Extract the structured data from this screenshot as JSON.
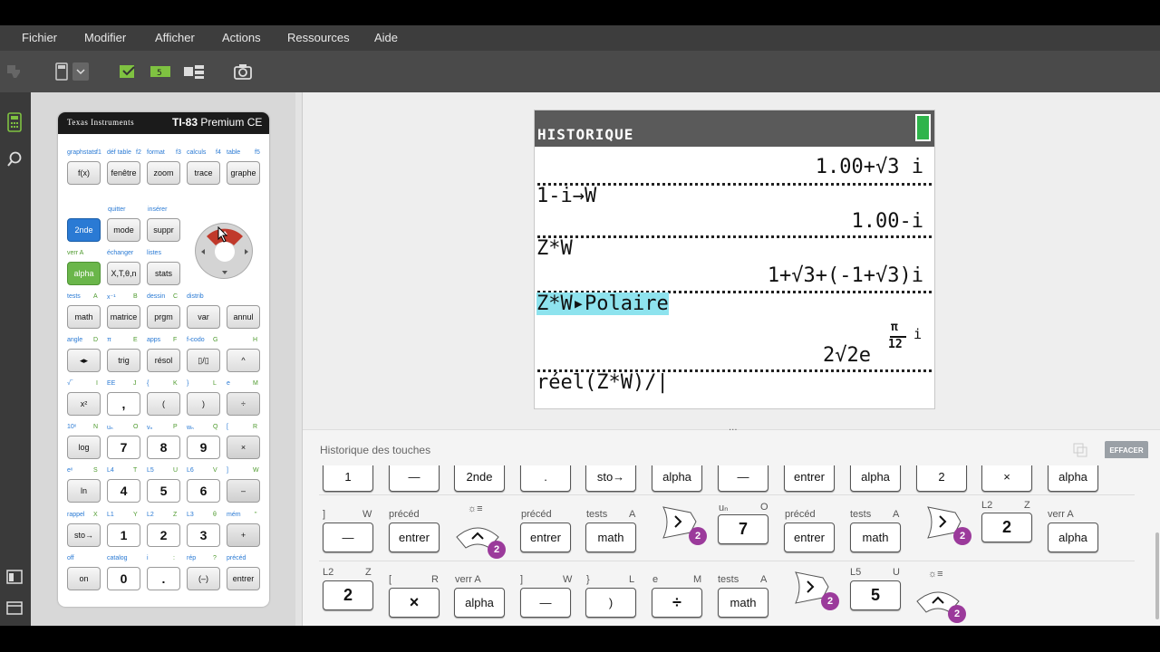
{
  "menu": [
    "Fichier",
    "Modifier",
    "Afficher",
    "Actions",
    "Ressources",
    "Aide"
  ],
  "calc": {
    "brand": "Texas Instruments",
    "model_bold": "TI-83",
    "model_rest": " Premium CE",
    "keys": {
      "fx": "f(x)",
      "fenetre": "fenêtre",
      "zoom": "zoom",
      "trace": "trace",
      "graphe": "graphe",
      "2nde": "2nde",
      "mode": "mode",
      "suppr": "suppr",
      "alpha": "alpha",
      "xtn": "X,T,θ,n",
      "stats": "stats",
      "math": "math",
      "matrice": "matrice",
      "prgm": "prgm",
      "var": "var",
      "annul": "annul",
      "frac": "◂▸",
      "trig": "trig",
      "resol": "résol",
      "frac2": "▯/▯",
      "pow": "^",
      "sq": "x²",
      "comma": ",",
      "lp": "(",
      "rp": ")",
      "div": "÷",
      "log": "log",
      "n7": "7",
      "n8": "8",
      "n9": "9",
      "mul": "×",
      "ln": "ln",
      "n4": "4",
      "n5": "5",
      "n6": "6",
      "minus": "–",
      "sto": "sto→",
      "n1": "1",
      "n2": "2",
      "n3": "3",
      "plus": "+",
      "on": "on",
      "n0": "0",
      "dot": ".",
      "neg": "(–)",
      "entrer": "entrer"
    },
    "labels": {
      "r1": [
        "graphstats",
        "f1",
        "déf table",
        "f2",
        "format",
        "f3",
        "calculs",
        "f4",
        "table",
        "f5"
      ],
      "quitter": "quitter",
      "inserer": "insérer",
      "verrA": "verr A",
      "echanger": "échanger",
      "listes": "listes",
      "tests": "tests",
      "A": "A",
      "xinv": "x⁻¹",
      "B": "B",
      "dessin": "dessin",
      "C": "C",
      "distrib": "distrib",
      "angle": "angle",
      "D": "D",
      "pi": "π",
      "E": "E",
      "apps": "apps",
      "F": "F",
      "fcodo": "f▫codo",
      "G": "G",
      "H": "H",
      "sqrt": "√‾",
      "I": "I",
      "EE": "EE",
      "J": "J",
      "lb": "{",
      "K": "K",
      "rb": "}",
      "L": "L",
      "e": "e",
      "M": "M",
      "tenx": "10ˣ",
      "N": "N",
      "un": "uₙ",
      "O": "O",
      "vn": "vₙ",
      "P": "P",
      "wn": "wₙ",
      "Q": "Q",
      "lsq": "[",
      "R": "R",
      "ex": "eˣ",
      "S": "S",
      "L4": "L4",
      "T": "T",
      "L5": "L5",
      "U": "U",
      "L6": "L6",
      "V": "V",
      "rsq": "]",
      "W": "W",
      "rappel": "rappel",
      "X": "X",
      "L1": "L1",
      "Y": "Y",
      "L2": "L2",
      "Z": "Z",
      "L3": "L3",
      "theta": "θ",
      "mem": "mém",
      "quote": "\"",
      "off": "off",
      "catalog": "catalog",
      "i": "i",
      "colon": ":",
      "rep": "rép",
      "question": "?",
      "preced": "précéd"
    }
  },
  "screen": {
    "title": "HISTORIQUE",
    "lines": [
      "1.00+√3 i",
      "1-i→W",
      "1.00-i",
      "Z*W",
      "1+√3+(-1+√3)i",
      "Z*W▸Polaire",
      "2√2e",
      "π",
      "12",
      "i",
      "réel(Z*W)/|"
    ]
  },
  "history": {
    "title": "Historique des touches",
    "clear": "EFFACER",
    "row0": [
      "1",
      "—",
      "2nde",
      ".",
      "sto→",
      "alpha",
      "—",
      "entrer",
      "alpha",
      "2",
      "×",
      "alpha"
    ],
    "row1_labels": [
      "]",
      "W",
      "précéd",
      "☼≡",
      "précéd",
      "tests",
      "A",
      "uₙ",
      "O",
      "précéd",
      "tests",
      "A",
      "L2",
      "Z",
      "verr A"
    ],
    "row1": [
      "—",
      "entrer",
      "entrer",
      "math",
      "7",
      "entrer",
      "math",
      "2",
      "alpha"
    ],
    "row2_labels": [
      "L2",
      "Z",
      "[",
      "R",
      "verr A",
      "]",
      "W",
      "}",
      "L",
      "e",
      "M",
      "tests",
      "A",
      "L5",
      "U",
      "☼≡"
    ],
    "row2": [
      "2",
      "×",
      "alpha",
      "—",
      ")",
      "÷",
      "math",
      "5"
    ],
    "badge": "2"
  },
  "colors": {
    "accent_blue": "#2a7ad4",
    "alpha_green": "#6ab64a",
    "badge": "#9b3a9b",
    "highlight": "#8ee3ee"
  }
}
